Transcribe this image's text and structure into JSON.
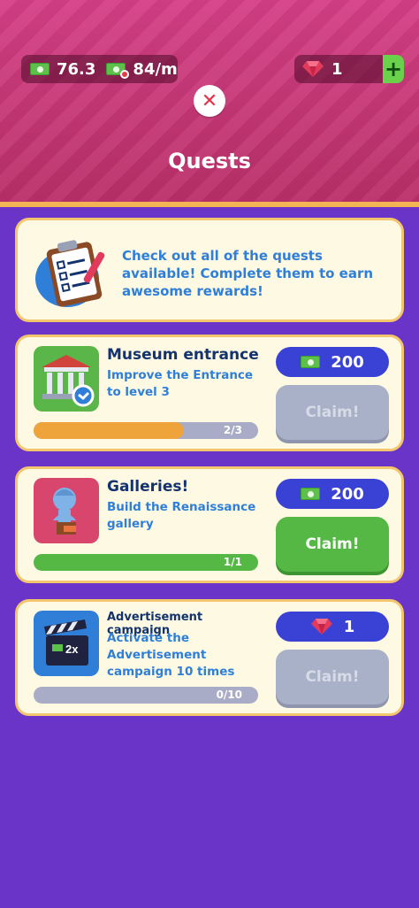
{
  "header": {
    "money_value": "76.3",
    "income_rate": "84/m",
    "gems_value": "1",
    "plus_label": "+",
    "close_label": "✕",
    "title": "Quests"
  },
  "info": {
    "text": "Check out all of the quests available! Complete them to earn awesome rewards!"
  },
  "quests": [
    {
      "title": "Museum entrance",
      "description": "Improve the Entrance to level 3",
      "progress_text": "2/3",
      "progress": 0.67,
      "reward_type": "cash",
      "reward_value": "200",
      "claim_label": "Claim!",
      "claim_enabled": false
    },
    {
      "title": "Galleries!",
      "description": "Build the Renaissance gallery",
      "progress_text": "1/1",
      "progress": 1.0,
      "reward_type": "cash",
      "reward_value": "200",
      "claim_label": "Claim!",
      "claim_enabled": true
    },
    {
      "title": "Advertisement campaign",
      "description": "Activate the Advertisement campaign 10 times",
      "progress_text": "0/10",
      "progress": 0.0,
      "reward_type": "gem",
      "reward_value": "1",
      "claim_label": "Claim!",
      "claim_enabled": false,
      "icon_badge": "2x"
    }
  ],
  "colors": {
    "background": "#6b34c8",
    "header": "#d43f86",
    "card": "#fdf9e3",
    "card_border": "#f3c56d",
    "progress_orange": "#eea43a",
    "progress_green": "#55b845",
    "reward_pill": "#3a42d6"
  }
}
